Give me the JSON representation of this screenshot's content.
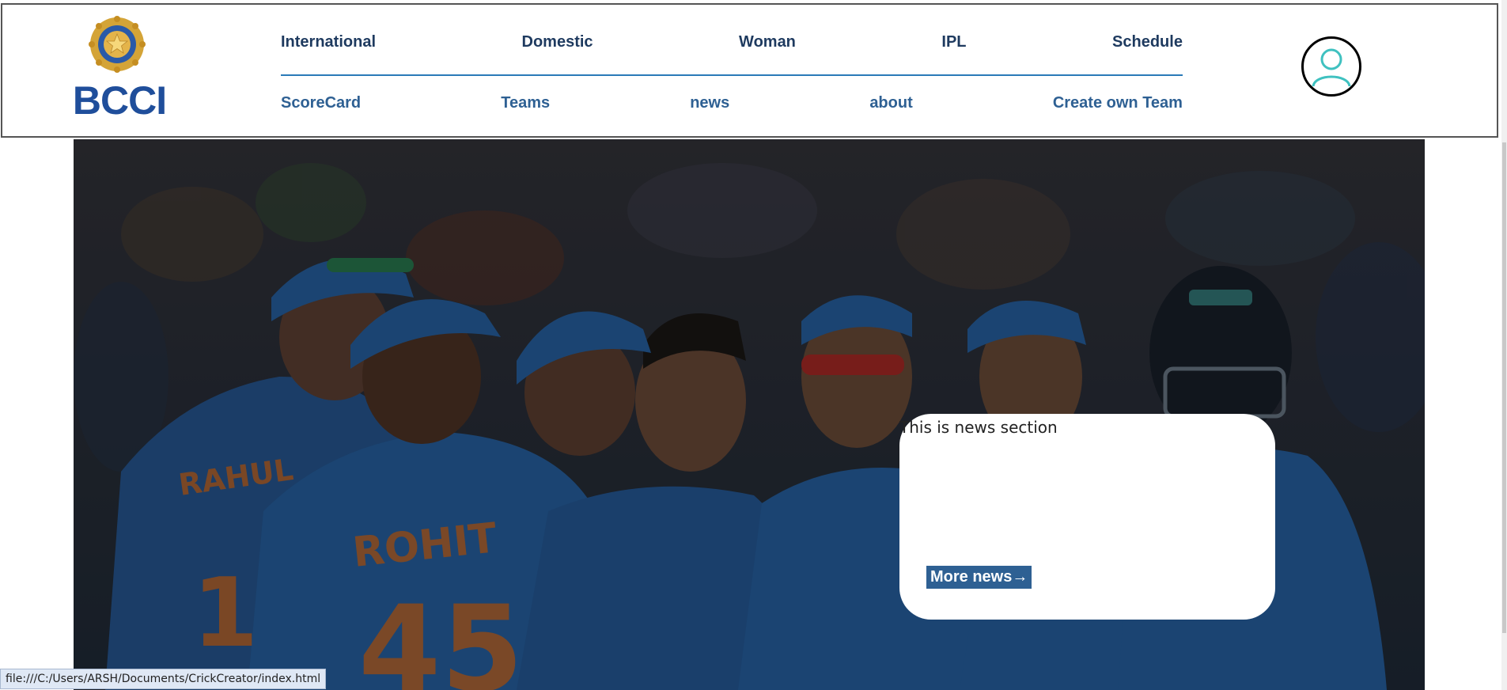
{
  "logo": {
    "text": "BCCI",
    "icon": "bcci-emblem-icon"
  },
  "nav": {
    "top": [
      {
        "label": "International"
      },
      {
        "label": "Domestic"
      },
      {
        "label": "Woman"
      },
      {
        "label": "IPL"
      },
      {
        "label": "Schedule"
      }
    ],
    "bottom": [
      {
        "label": "ScoreCard"
      },
      {
        "label": "Teams"
      },
      {
        "label": "news"
      },
      {
        "label": "about"
      },
      {
        "label": "Create own Team"
      }
    ]
  },
  "profile": {
    "icon": "user-profile-icon"
  },
  "hero": {
    "jerseys": [
      {
        "name": "RAHUL",
        "number": "1"
      },
      {
        "name": "ROHIT",
        "number": "45"
      }
    ]
  },
  "news": {
    "text": "This is news section",
    "button_label": "More news→"
  },
  "status_bar": {
    "url": "file:///C:/Users/ARSH/Documents/CrickCreator/index.html"
  },
  "colors": {
    "nav_top": "#1e3a5f",
    "nav_bottom": "#2e6093",
    "brand": "#1f4e9b",
    "jersey_blue": "#2c6fb8",
    "jersey_orange": "#e2762b"
  }
}
